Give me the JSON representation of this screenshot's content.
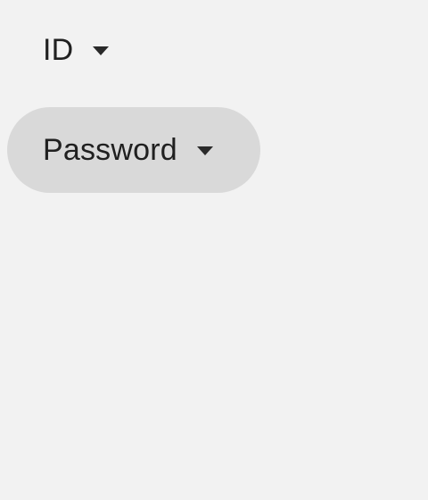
{
  "dropdowns": {
    "id": {
      "label": "ID",
      "icon": "triangle-down-icon"
    },
    "password": {
      "label": "Password",
      "icon": "triangle-down-icon",
      "state": "selected"
    }
  },
  "colors": {
    "background": "#f2f2f2",
    "selected_background": "#d9d9d9",
    "text": "#202020"
  }
}
